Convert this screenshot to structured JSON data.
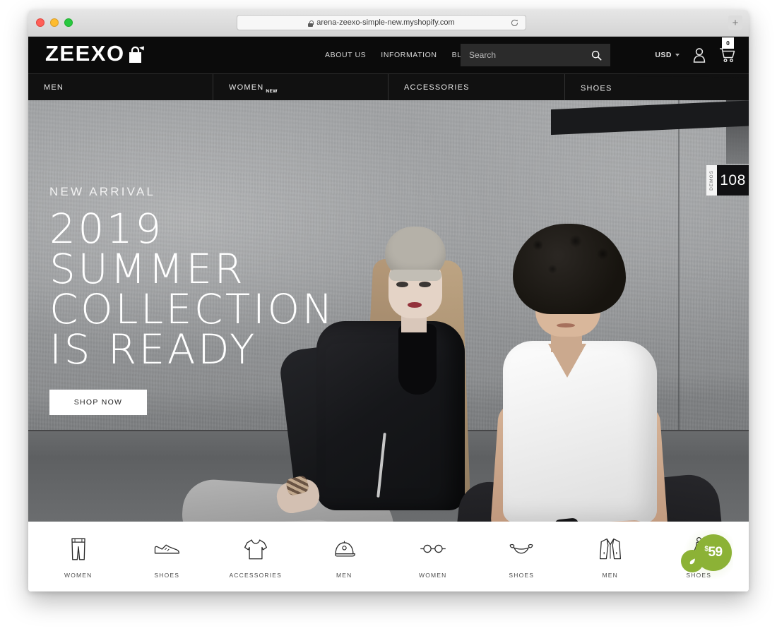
{
  "browser": {
    "url": "arena-zeexo-simple-new.myshopify.com",
    "lock_icon": "lock-icon",
    "reload_icon": "reload-icon",
    "new_tab_label": "+",
    "traffic_lights": [
      "close-red",
      "minimize-yellow",
      "maximize-green"
    ]
  },
  "header": {
    "logo_text": "ZEEXO",
    "logo_icon": "shopping-bag-icon",
    "nav": [
      {
        "label": "ABOUT US"
      },
      {
        "label": "INFORMATION"
      },
      {
        "label": "BLOG"
      }
    ],
    "search": {
      "placeholder": "Search",
      "value": "",
      "icon": "search-icon"
    },
    "currency": {
      "label": "USD",
      "caret_icon": "chevron-down-icon"
    },
    "account_icon": "user-icon",
    "cart": {
      "icon": "shopping-cart-icon",
      "count": "0"
    }
  },
  "main_nav": [
    {
      "label": "MEN",
      "badge": ""
    },
    {
      "label": "WOMEN",
      "badge": "NEW"
    },
    {
      "label": "ACCESSORIES",
      "badge": ""
    },
    {
      "label": "SHOES",
      "badge": ""
    }
  ],
  "hero": {
    "eyebrow": "NEW ARRIVAL",
    "title_line1": "2019",
    "title_line2": "SUMMER",
    "title_line3": "COLLECTION",
    "title_line4": "IS READY",
    "cta_label": "SHOP NOW"
  },
  "demos_tab": {
    "label": "DEMOS",
    "count": "108"
  },
  "categories": [
    {
      "label": "WOMEN",
      "icon": "pants-icon"
    },
    {
      "label": "SHOES",
      "icon": "sneaker-icon"
    },
    {
      "label": "ACCESSORIES",
      "icon": "tshirt-icon"
    },
    {
      "label": "MEN",
      "icon": "cap-icon"
    },
    {
      "label": "WOMEN",
      "icon": "glasses-icon"
    },
    {
      "label": "SHOES",
      "icon": "bikini-icon"
    },
    {
      "label": "MEN",
      "icon": "jacket-icon"
    },
    {
      "label": "SHOES",
      "icon": "dress-icon"
    }
  ],
  "price_bubble": {
    "currency_symbol": "$",
    "amount": "59",
    "accent_color": "#8cb236",
    "icon": "leaf-icon"
  },
  "colors": {
    "header_bg": "#0b0b0b",
    "nav_bg": "#111111",
    "search_bg": "#2b2b2b",
    "accent_green": "#8cb236",
    "page_bg": "#ffffff"
  }
}
